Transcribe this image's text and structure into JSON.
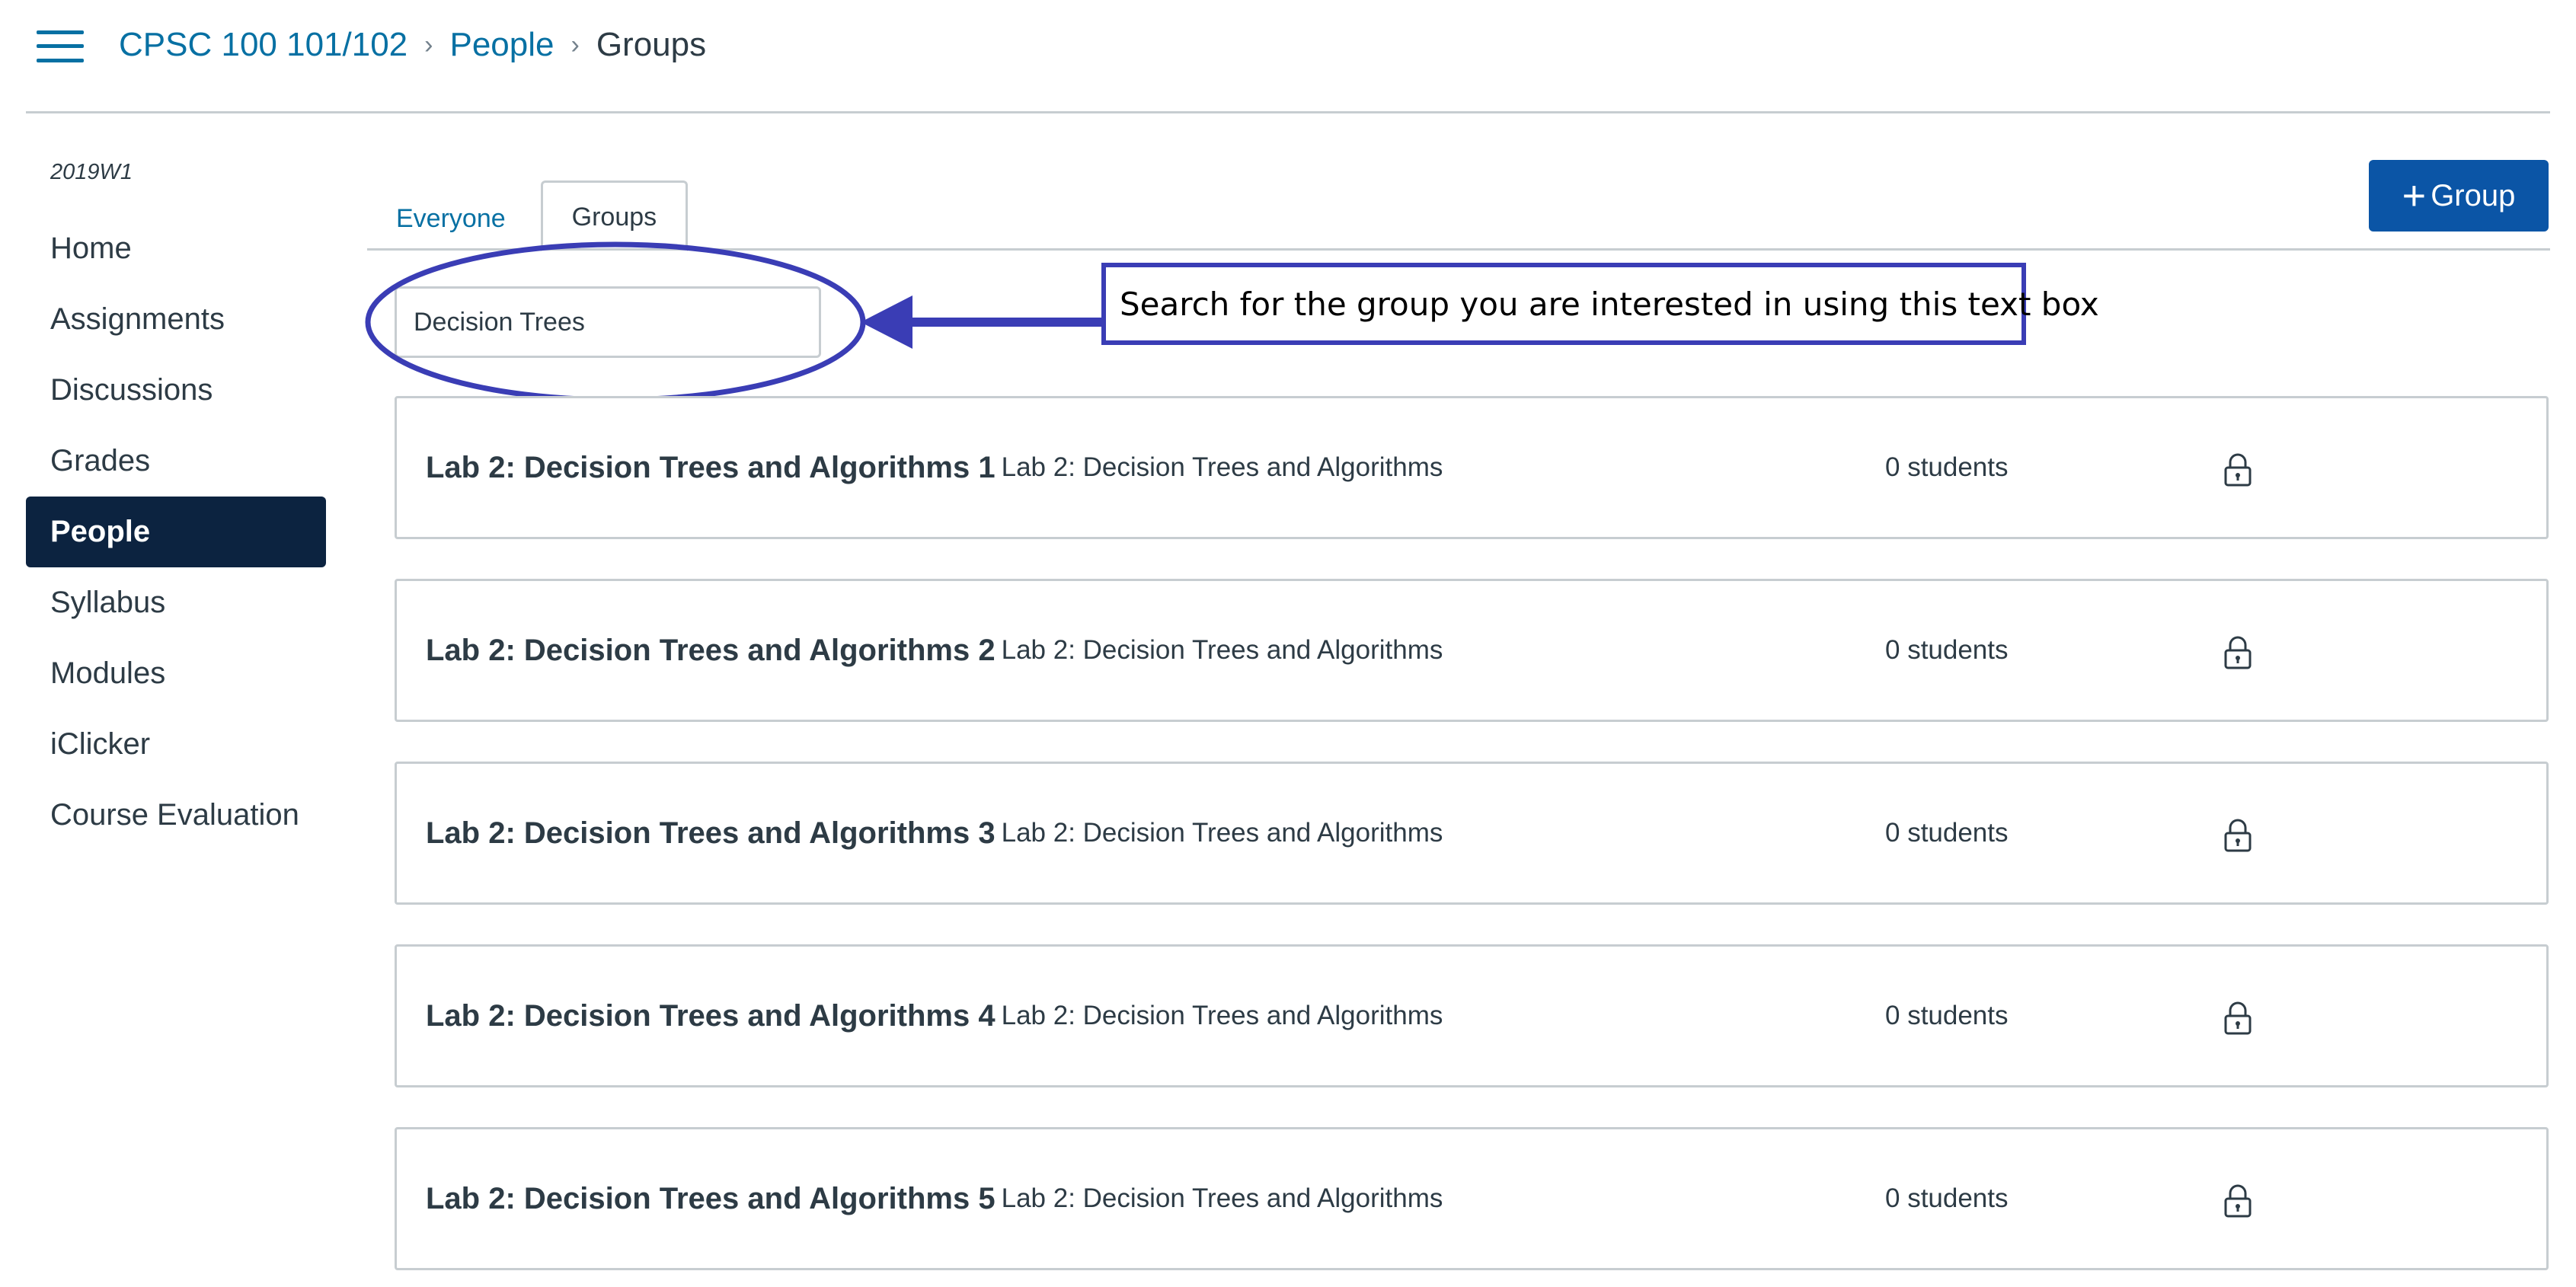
{
  "breadcrumb": {
    "course": "CPSC 100 101/102",
    "section": "People",
    "current": "Groups",
    "separator": "›"
  },
  "sidebar": {
    "term": "2019W1",
    "items": [
      {
        "label": "Home"
      },
      {
        "label": "Assignments"
      },
      {
        "label": "Discussions"
      },
      {
        "label": "Grades"
      },
      {
        "label": "People",
        "active": true
      },
      {
        "label": "Syllabus"
      },
      {
        "label": "Modules"
      },
      {
        "label": "iClicker"
      },
      {
        "label": "Course Evaluation"
      }
    ]
  },
  "tabs": [
    {
      "label": "Everyone",
      "selected": false
    },
    {
      "label": "Groups",
      "selected": true
    }
  ],
  "add_group_button": {
    "icon": "plus-icon",
    "label": "Group"
  },
  "search": {
    "value": "Decision Trees"
  },
  "annotation": {
    "text": "Search for the group you are interested in using this text box"
  },
  "groups": [
    {
      "name": "Lab 2: Decision Trees and Algorithms 1",
      "category": "Lab 2: Decision Trees and Algorithms",
      "students": "0 students",
      "icon": "lock-icon"
    },
    {
      "name": "Lab 2: Decision Trees and Algorithms 2",
      "category": "Lab 2: Decision Trees and Algorithms",
      "students": "0 students",
      "icon": "lock-icon"
    },
    {
      "name": "Lab 2: Decision Trees and Algorithms 3",
      "category": "Lab 2: Decision Trees and Algorithms",
      "students": "0 students",
      "icon": "lock-icon"
    },
    {
      "name": "Lab 2: Decision Trees and Algorithms 4",
      "category": "Lab 2: Decision Trees and Algorithms",
      "students": "0 students",
      "icon": "lock-icon"
    },
    {
      "name": "Lab 2: Decision Trees and Algorithms 5",
      "category": "Lab 2: Decision Trees and Algorithms",
      "students": "0 students",
      "icon": "lock-icon"
    }
  ],
  "colors": {
    "link": "#0770a3",
    "active_nav": "#0c2340",
    "primary_button": "#0b55a6",
    "annotation": "#3a3db5",
    "border": "#c7cdd1"
  }
}
